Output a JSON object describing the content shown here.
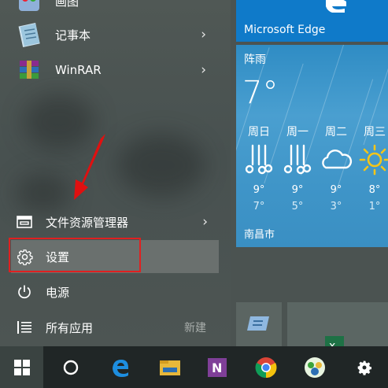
{
  "app_list": {
    "items": [
      {
        "label": "画图"
      },
      {
        "label": "记事本"
      },
      {
        "label": "WinRAR"
      }
    ]
  },
  "system_items": {
    "file_explorer": "文件资源管理器",
    "settings": "设置",
    "power": "电源",
    "all_apps": "所有应用",
    "new_badge": "新建"
  },
  "tiles": {
    "edge": {
      "name": "Microsoft Edge"
    },
    "weather": {
      "condition": "阵雨",
      "temperature": "7°",
      "city": "南昌市",
      "forecast": [
        {
          "day": "周日",
          "icon": "rain-icon",
          "high": "9°",
          "low": "7°"
        },
        {
          "day": "周一",
          "icon": "rain-icon",
          "high": "9°",
          "low": "5°"
        },
        {
          "day": "周二",
          "icon": "cloud-icon",
          "high": "9°",
          "low": "3°"
        },
        {
          "day": "周三",
          "icon": "sun-icon",
          "high": "8°",
          "low": "1°"
        }
      ]
    }
  },
  "taskbar": {
    "items": [
      "windows-start-icon",
      "cortana-icon",
      "edge-icon",
      "file-explorer-icon",
      "onenote-icon",
      "chrome-icon",
      "baidu-icon",
      "settings-gear-icon"
    ]
  },
  "colors": {
    "accent": "#0f7ac9",
    "highlight_border": "#e02020",
    "taskbar": "#202626"
  }
}
